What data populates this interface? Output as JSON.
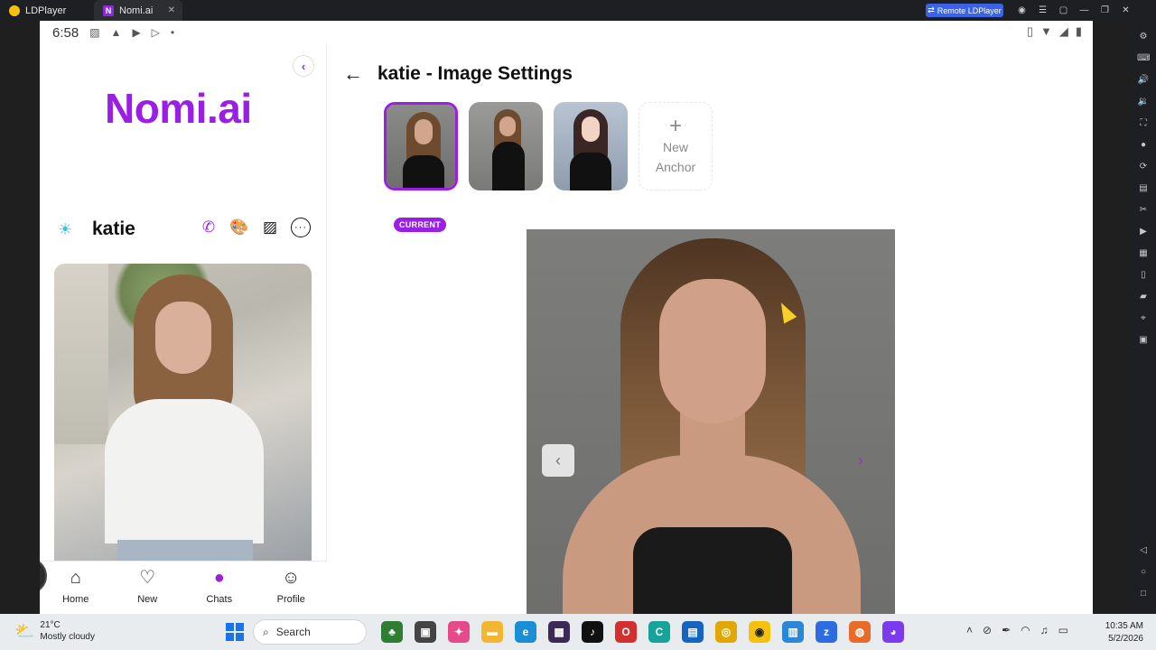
{
  "window": {
    "app_tab": "LDPlayer",
    "active_tab": "Nomi.ai",
    "remote_label": "Remote LDPlayer"
  },
  "status_bar": {
    "time": "6:58"
  },
  "sidebar": {
    "brand": "Nomi.ai",
    "nomi_name": "katie",
    "nav": [
      {
        "label": "Home",
        "icon": "home-icon"
      },
      {
        "label": "New",
        "icon": "heart-plus-icon"
      },
      {
        "label": "Chats",
        "icon": "chat-bubble-icon",
        "active": true
      },
      {
        "label": "Profile",
        "icon": "person-icon"
      }
    ]
  },
  "main": {
    "title": "katie - Image Settings",
    "current_badge": "CURRENT",
    "new_anchor": {
      "line1": "New",
      "line2": "Anchor"
    },
    "thumbnails": [
      {
        "style": "realistic",
        "current": true
      },
      {
        "style": "realistic-full-body",
        "current": false
      },
      {
        "style": "anime",
        "current": false
      }
    ]
  },
  "taskbar": {
    "weather_temp": "21°C",
    "weather_desc": "Mostly cloudy",
    "search_placeholder": "Search",
    "time": "10:35 AM",
    "date": "5/2/2026"
  },
  "colors": {
    "accent": "#9b1ee6",
    "remote_button": "#3a63e8"
  }
}
